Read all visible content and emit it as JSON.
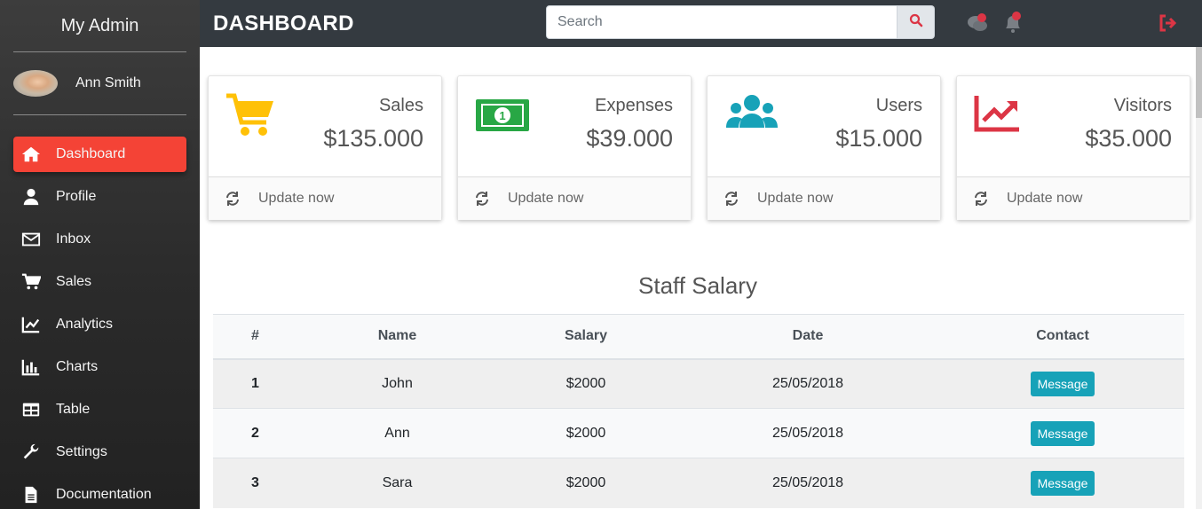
{
  "sidebar": {
    "brand": "My Admin",
    "user_name": "Ann Smith",
    "items": [
      {
        "label": "Dashboard",
        "icon": "home-icon"
      },
      {
        "label": "Profile",
        "icon": "user-icon"
      },
      {
        "label": "Inbox",
        "icon": "envelope-icon"
      },
      {
        "label": "Sales",
        "icon": "cart-icon"
      },
      {
        "label": "Analytics",
        "icon": "line-chart-icon"
      },
      {
        "label": "Charts",
        "icon": "bar-chart-icon"
      },
      {
        "label": "Table",
        "icon": "table-icon"
      },
      {
        "label": "Settings",
        "icon": "wrench-icon"
      },
      {
        "label": "Documentation",
        "icon": "file-icon"
      }
    ]
  },
  "topbar": {
    "title": "DASHBOARD",
    "search_placeholder": "Search"
  },
  "cards": [
    {
      "label": "Sales",
      "value": "$135.000",
      "footer": "Update now",
      "icon": "cart-icon",
      "color": "#ffc107"
    },
    {
      "label": "Expenses",
      "value": "$39.000",
      "footer": "Update now",
      "icon": "money-bill-icon",
      "color": "#28a745"
    },
    {
      "label": "Users",
      "value": "$15.000",
      "footer": "Update now",
      "icon": "users-icon",
      "color": "#17a2b8"
    },
    {
      "label": "Visitors",
      "value": "$35.000",
      "footer": "Update now",
      "icon": "chart-line-icon",
      "color": "#dc3545"
    }
  ],
  "table": {
    "title": "Staff Salary",
    "headers": [
      "#",
      "Name",
      "Salary",
      "Date",
      "Contact"
    ],
    "rows": [
      {
        "num": "1",
        "name": "John",
        "salary": "$2000",
        "date": "25/05/2018",
        "action": "Message"
      },
      {
        "num": "2",
        "name": "Ann",
        "salary": "$2000",
        "date": "25/05/2018",
        "action": "Message"
      },
      {
        "num": "3",
        "name": "Sara",
        "salary": "$2000",
        "date": "25/05/2018",
        "action": "Message"
      }
    ]
  },
  "colors": {
    "sidebar_active": "#f44336",
    "topbar_bg": "#343a40",
    "accent_danger": "#dc3545",
    "button_info": "#17a2b8"
  }
}
